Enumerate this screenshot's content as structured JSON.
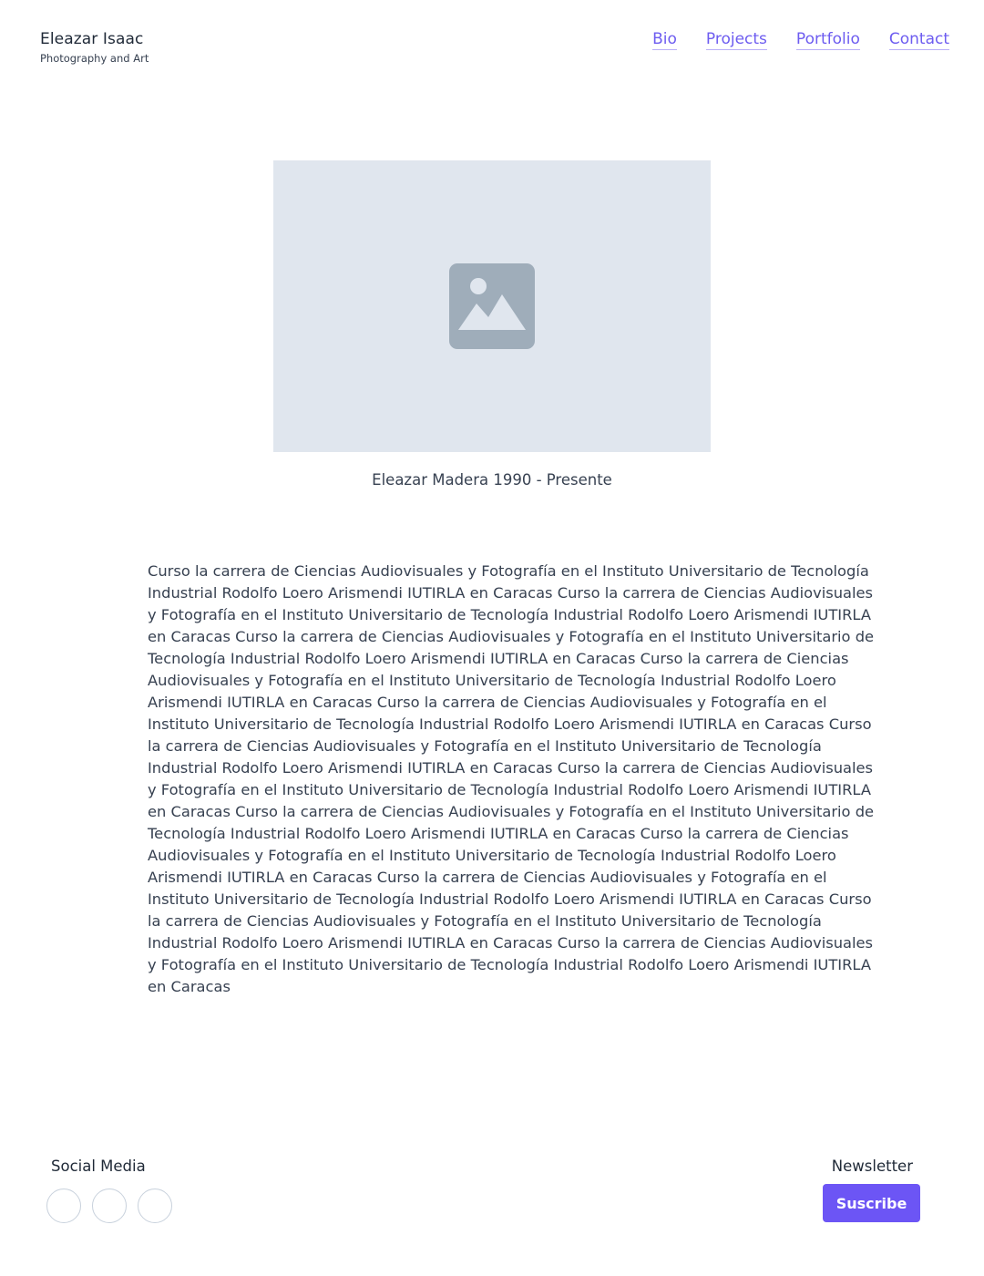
{
  "header": {
    "brand_name": "Eleazar Isaac",
    "brand_subtitle": "Photography and Art",
    "nav": [
      {
        "label": "Bio"
      },
      {
        "label": "Projects"
      },
      {
        "label": "Portfolio"
      },
      {
        "label": "Contact"
      }
    ]
  },
  "hero": {
    "icon": "image-placeholder-icon",
    "caption": "Eleazar Madera 1990 - Presente"
  },
  "bio": {
    "text": "Curso la carrera de Ciencias Audiovisuales y Fotografía en el Instituto Universitario de Tecnología Industrial Rodolfo Loero Arismendi IUTIRLA en Caracas Curso la carrera de Ciencias Audiovisuales y Fotografía en el Instituto Universitario de Tecnología Industrial Rodolfo Loero Arismendi IUTIRLA en Caracas Curso la carrera de Ciencias Audiovisuales y Fotografía en el Instituto Universitario de Tecnología Industrial Rodolfo Loero Arismendi IUTIRLA en Caracas Curso la carrera de Ciencias Audiovisuales y Fotografía en el Instituto Universitario de Tecnología Industrial Rodolfo Loero Arismendi IUTIRLA en Caracas Curso la carrera de Ciencias Audiovisuales y Fotografía en el Instituto Universitario de Tecnología Industrial Rodolfo Loero Arismendi IUTIRLA en Caracas Curso la carrera de Ciencias Audiovisuales y Fotografía en el Instituto Universitario de Tecnología Industrial Rodolfo Loero Arismendi IUTIRLA en Caracas Curso la carrera de Ciencias Audiovisuales y Fotografía en el Instituto Universitario de Tecnología Industrial Rodolfo Loero Arismendi IUTIRLA en Caracas Curso la carrera de Ciencias Audiovisuales y Fotografía en el Instituto Universitario de Tecnología Industrial Rodolfo Loero Arismendi IUTIRLA en Caracas Curso la carrera de Ciencias Audiovisuales y Fotografía en el Instituto Universitario de Tecnología Industrial Rodolfo Loero Arismendi IUTIRLA en Caracas Curso la carrera de Ciencias Audiovisuales y Fotografía en el Instituto Universitario de Tecnología Industrial Rodolfo Loero Arismendi IUTIRLA en Caracas Curso la carrera de Ciencias Audiovisuales y Fotografía en el Instituto Universitario de Tecnología Industrial Rodolfo Loero Arismendi IUTIRLA en Caracas Curso la carrera de Ciencias Audiovisuales y Fotografía en el Instituto Universitario de Tecnología Industrial Rodolfo Loero Arismendi IUTIRLA en Caracas"
  },
  "footer": {
    "social_title": "Social Media",
    "social_links": [
      {
        "icon": "social-icon-1"
      },
      {
        "icon": "social-icon-2"
      },
      {
        "icon": "social-icon-3"
      }
    ],
    "newsletter_title": "Newsletter",
    "subscribe_label": "Suscribe"
  },
  "colors": {
    "accent": "#6c55f5",
    "link": "#6d5cf0",
    "placeholder_bg": "#e0e6ee",
    "placeholder_icon": "#9fadba",
    "circle_border": "#c8d1dc"
  }
}
